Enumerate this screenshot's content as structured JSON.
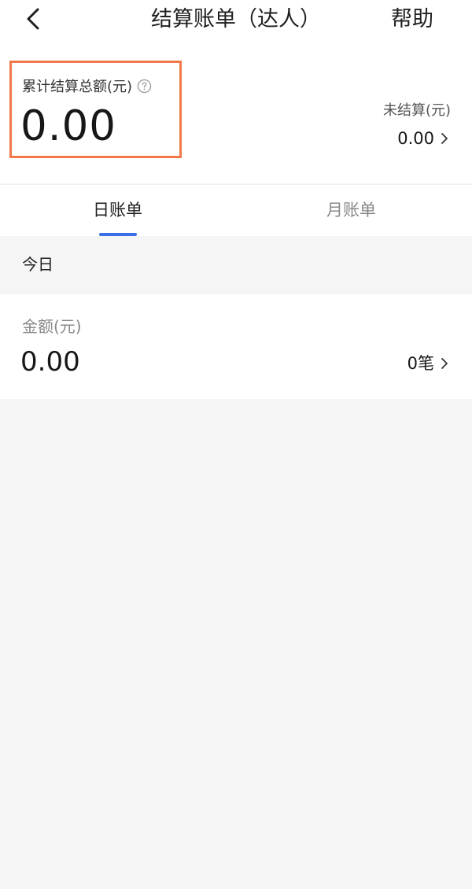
{
  "header": {
    "title": "结算账单（达人）",
    "help_label": "帮助",
    "back_icon": "back-arrow-icon"
  },
  "summary": {
    "total_label": "累计结算总额(元)",
    "total_value": "0.00",
    "help_icon": "question-circle-icon",
    "highlight_color": "#f0784a",
    "unsettled_label": "未结算(元)",
    "unsettled_value": "0.00"
  },
  "tabs": [
    {
      "label": "日账单",
      "active": true
    },
    {
      "label": "月账单",
      "active": false
    }
  ],
  "accent_color": "#3b6fe5",
  "daily": {
    "section_title": "今日",
    "amount_label": "金额(元)",
    "amount_value": "0.00",
    "count": "0笔"
  }
}
